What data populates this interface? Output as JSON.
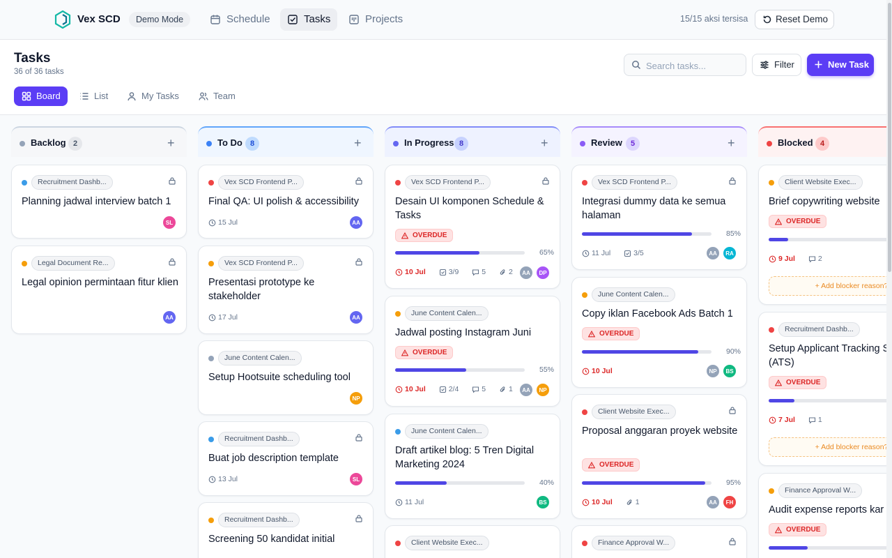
{
  "app": {
    "brand": "Vex SCD",
    "demo_badge": "Demo Mode",
    "nav": [
      "Schedule",
      "Tasks",
      "Projects"
    ],
    "actions_left": "15/15 aksi tersisa",
    "reset": "Reset Demo"
  },
  "page": {
    "title": "Tasks",
    "subtitle": "36 of 36 tasks",
    "search_placeholder": "Search tasks...",
    "filter": "Filter",
    "new_task": "New Task",
    "views": [
      "Board",
      "List",
      "My Tasks",
      "Team"
    ]
  },
  "colors": {
    "accent": "#5b3df5",
    "overdue": "#dc2626",
    "progress": "#4f46e5"
  },
  "columns": [
    {
      "name": "Backlog",
      "count": "2",
      "cards": [
        {
          "project": "Recruitment Dashb...",
          "title": "Planning jadwal interview batch 1",
          "lock": true,
          "avatars": [
            "SL"
          ]
        },
        {
          "project": "Legal Document Re...",
          "title": "Legal opinion permintaan fitur klien",
          "lock": true,
          "avatars": [
            "AA"
          ]
        }
      ]
    },
    {
      "name": "To Do",
      "count": "8",
      "cards": [
        {
          "project": "Vex SCD Frontend P...",
          "title": "Final QA: UI polish & accessibility",
          "lock": true,
          "date": "15 Jul",
          "avatars": [
            "AA"
          ]
        },
        {
          "project": "Vex SCD Frontend P...",
          "title": "Presentasi prototype ke stakeholder",
          "lock": true,
          "date": "17 Jul",
          "avatars": [
            "AA"
          ]
        },
        {
          "project": "June Content Calen...",
          "title": "Setup Hootsuite scheduling tool",
          "avatars": [
            "NP"
          ]
        },
        {
          "project": "Recruitment Dashb...",
          "title": "Buat job description template",
          "lock": true,
          "date": "13 Jul",
          "avatars": [
            "SL"
          ]
        },
        {
          "project": "Recruitment Dashb...",
          "title": "Screening 50 kandidat initial",
          "lock": true
        }
      ]
    },
    {
      "name": "In Progress",
      "count": "8",
      "cards": [
        {
          "project": "Vex SCD Frontend P...",
          "title": "Desain UI komponen Schedule & Tasks",
          "lock": true,
          "overdue": "OVERDUE",
          "progress": 65,
          "pct": "65%",
          "date": "10 Jul",
          "subtasks": "3/9",
          "comments": "5",
          "attachments": "2",
          "avatars": [
            "AA",
            "DP"
          ]
        },
        {
          "project": "June Content Calen...",
          "title": "Jadwal posting Instagram Juni",
          "overdue": "OVERDUE",
          "progress": 55,
          "pct": "55%",
          "date": "10 Jul",
          "subtasks": "2/4",
          "comments": "5",
          "attachments": "1",
          "avatars": [
            "AA",
            "NP"
          ]
        },
        {
          "project": "June Content Calen...",
          "title": "Draft artikel blog: 5 Tren Digital Marketing 2024",
          "progress": 40,
          "pct": "40%",
          "date": "11 Jul",
          "avatars": [
            "BS"
          ]
        },
        {
          "project": "Client Website Exec..."
        }
      ]
    },
    {
      "name": "Review",
      "count": "5",
      "cards": [
        {
          "project": "Vex SCD Frontend P...",
          "title": "Integrasi dummy data ke semua halaman",
          "lock": true,
          "progress": 85,
          "pct": "85%",
          "date": "11 Jul",
          "subtasks": "3/5",
          "avatars": [
            "AA",
            "RA"
          ]
        },
        {
          "project": "June Content Calen...",
          "title": "Copy iklan Facebook Ads Batch 1",
          "overdue": "OVERDUE",
          "progress": 90,
          "pct": "90%",
          "date": "10 Jul",
          "avatars": [
            "NP",
            "BS"
          ]
        },
        {
          "project": "Client Website Exec...",
          "title": "Proposal anggaran proyek website",
          "lock": true,
          "overdue": "OVERDUE",
          "progress": 95,
          "pct": "95%",
          "date": "10 Jul",
          "attachments": "1",
          "avatars": [
            "AA",
            "FH"
          ]
        },
        {
          "project": "Finance Approval W...",
          "lock": true
        }
      ]
    },
    {
      "name": "Blocked",
      "count": "4",
      "cards": [
        {
          "project": "Client Website Exec...",
          "title": "Brief copywriting website",
          "overdue": "OVERDUE",
          "date": "9 Jul",
          "comments": "2",
          "blocker": "+ Add blocker reason?"
        },
        {
          "project": "Recruitment Dashb...",
          "title": "Setup Applicant Tracking System (ATS)",
          "overdue": "OVERDUE",
          "date": "7 Jul",
          "comments": "1",
          "blocker": "+ Add blocker reason?"
        },
        {
          "project": "Finance Approval W...",
          "title": "Audit expense reports kar",
          "overdue": "OVERDUE"
        }
      ]
    }
  ]
}
